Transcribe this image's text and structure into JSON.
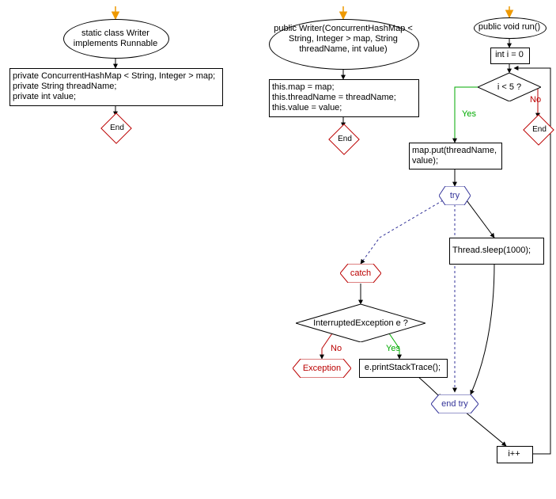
{
  "col1": {
    "class_decl": "static class Writer implements Runnable",
    "fields": "private ConcurrentHashMap < String, Integer > map;\nprivate String threadName;\nprivate int value;",
    "end": "End"
  },
  "col2": {
    "constructor": "public Writer(ConcurrentHashMap < String, Integer > map, String threadName, int value)",
    "body": "this.map = map;\nthis.threadName = threadName;\nthis.value = value;",
    "end": "End"
  },
  "col3": {
    "method": "public void run()",
    "init": "int i = 0",
    "cond": "i < 5 ?",
    "yes": "Yes",
    "no": "No",
    "put": "map.put(threadName, value);",
    "try": "try",
    "sleep": "Thread.sleep(1000);",
    "catch": "catch",
    "catch_cond": "InterruptedException e ?",
    "catch_yes": "Yes",
    "catch_no": "No",
    "exception": "Exception",
    "stacktrace": "e.printStackTrace();",
    "endtry": "end try",
    "inc": "i++",
    "end": "End"
  }
}
